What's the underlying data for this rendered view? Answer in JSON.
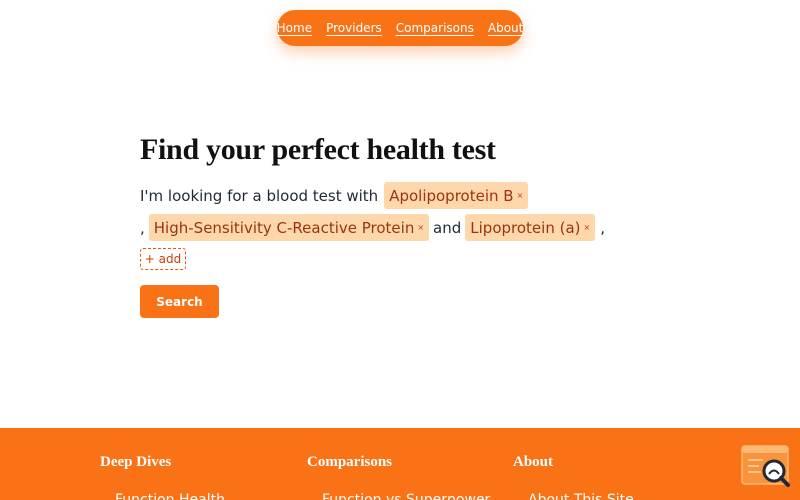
{
  "nav": {
    "items": [
      {
        "label": "Home"
      },
      {
        "label": "Providers"
      },
      {
        "label": "Comparisons"
      },
      {
        "label": "About"
      }
    ]
  },
  "hero": {
    "title": "Find your perfect health test",
    "intro": "I'm looking for a blood test with",
    "separator_comma": ",",
    "conjunction": "and",
    "trailing_comma": ",",
    "chips": [
      {
        "label": "Apolipoprotein B",
        "remove": "×"
      },
      {
        "label": "High-Sensitivity C-Reactive Protein",
        "remove": "×"
      },
      {
        "label": "Lipoprotein (a)",
        "remove": "×"
      }
    ],
    "add_label": "+ add",
    "search_label": "Search"
  },
  "footer": {
    "columns": [
      {
        "heading": "Deep Dives",
        "link": "Function Health"
      },
      {
        "heading": "Comparisons",
        "link": "Function vs Superpower"
      },
      {
        "heading": "About",
        "link": "About This Site"
      }
    ]
  },
  "colors": {
    "accent": "#f97316",
    "chip_bg": "#fed7aa",
    "chip_text": "#9a3412"
  },
  "icons": {
    "widget": "search-document-icon"
  }
}
